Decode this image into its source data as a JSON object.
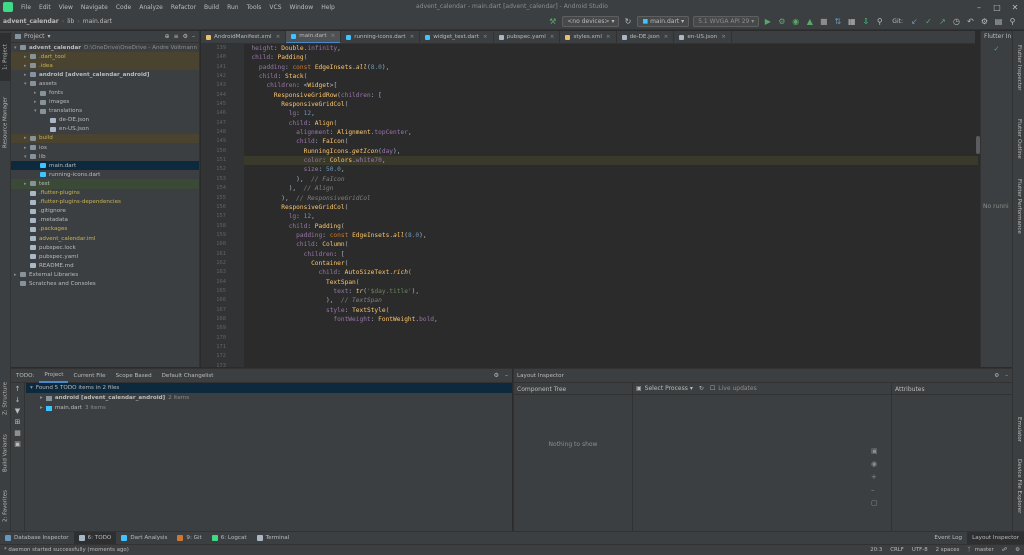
{
  "window": {
    "title": "advent_calendar - main.dart [advent_calendar] - Android Studio",
    "menu": [
      "File",
      "Edit",
      "View",
      "Navigate",
      "Code",
      "Analyze",
      "Refactor",
      "Build",
      "Run",
      "Tools",
      "VCS",
      "Window",
      "Help"
    ]
  },
  "navbar": {
    "breadcrumbs": [
      "advent_calendar",
      "lib",
      "main.dart"
    ],
    "device": "<no devices>",
    "run_config": "main.dart",
    "emulator": "5.1 WVGA API 29",
    "git_label": "Git:"
  },
  "left_stripe": [
    "1: Project",
    "Resource Manager",
    "Z: Structure",
    "Build Variants",
    "2: Favorites"
  ],
  "right_stripe": [
    "Flutter Inspector",
    "Flutter Outline",
    "Flutter Performance",
    "Emulator",
    "Device File Explorer"
  ],
  "project": {
    "header": "Project",
    "tree": [
      {
        "label": "advent_calendar",
        "extra": "D:\\OneDrive\\OneDrive - Andre Voltmann",
        "depth": 0,
        "type": "folder",
        "state": "open",
        "style": "bold"
      },
      {
        "label": ".dart_tool",
        "depth": 1,
        "type": "folder",
        "state": "closed",
        "style": "excluded"
      },
      {
        "label": ".idea",
        "depth": 1,
        "type": "folder",
        "state": "closed",
        "style": "excluded"
      },
      {
        "label": "android [advent_calendar_android]",
        "depth": 1,
        "type": "folder",
        "state": "closed",
        "style": "bold"
      },
      {
        "label": "assets",
        "depth": 1,
        "type": "folder",
        "state": "open",
        "style": ""
      },
      {
        "label": "fonts",
        "depth": 2,
        "type": "folder",
        "state": "closed",
        "style": ""
      },
      {
        "label": "images",
        "depth": 2,
        "type": "folder",
        "state": "closed",
        "style": ""
      },
      {
        "label": "translations",
        "depth": 2,
        "type": "folder",
        "state": "open",
        "style": ""
      },
      {
        "label": "de-DE.json",
        "depth": 3,
        "type": "file",
        "state": "",
        "style": ""
      },
      {
        "label": "en-US.json",
        "depth": 3,
        "type": "file",
        "state": "",
        "style": ""
      },
      {
        "label": "build",
        "depth": 1,
        "type": "folder",
        "state": "closed",
        "style": "excluded"
      },
      {
        "label": "ios",
        "depth": 1,
        "type": "folder",
        "state": "closed",
        "style": ""
      },
      {
        "label": "lib",
        "depth": 1,
        "type": "folder",
        "state": "open",
        "style": ""
      },
      {
        "label": "main.dart",
        "depth": 2,
        "type": "dart",
        "state": "",
        "style": "selected"
      },
      {
        "label": "running-icons.dart",
        "depth": 2,
        "type": "dart",
        "state": "",
        "style": ""
      },
      {
        "label": "test",
        "depth": 1,
        "type": "folder",
        "state": "closed",
        "style": "test"
      },
      {
        "label": ".flutter-plugins",
        "depth": 1,
        "type": "file",
        "state": "",
        "style": "yellow"
      },
      {
        "label": ".flutter-plugins-dependencies",
        "depth": 1,
        "type": "file",
        "state": "",
        "style": "yellow"
      },
      {
        "label": ".gitignore",
        "depth": 1,
        "type": "file",
        "state": "",
        "style": ""
      },
      {
        "label": ".metadata",
        "depth": 1,
        "type": "file",
        "state": "",
        "style": ""
      },
      {
        "label": ".packages",
        "depth": 1,
        "type": "file",
        "state": "",
        "style": "yellow"
      },
      {
        "label": "advent_calendar.iml",
        "depth": 1,
        "type": "file",
        "state": "",
        "style": "yellow"
      },
      {
        "label": "pubspec.lock",
        "depth": 1,
        "type": "file",
        "state": "",
        "style": ""
      },
      {
        "label": "pubspec.yaml",
        "depth": 1,
        "type": "file",
        "state": "",
        "style": ""
      },
      {
        "label": "README.md",
        "depth": 1,
        "type": "file",
        "state": "",
        "style": ""
      },
      {
        "label": "External Libraries",
        "depth": 0,
        "type": "folder",
        "state": "closed",
        "style": ""
      },
      {
        "label": "Scratches and Consoles",
        "depth": 0,
        "type": "folder",
        "state": "",
        "style": ""
      }
    ]
  },
  "editor": {
    "tabs": [
      {
        "label": "AndroidManifest.xml",
        "color": "#e8bf6a"
      },
      {
        "label": "main.dart",
        "color": "#40c4ff",
        "active": true
      },
      {
        "label": "running-icons.dart",
        "color": "#40c4ff"
      },
      {
        "label": "widget_test.dart",
        "color": "#40c4ff"
      },
      {
        "label": "pubspec.yaml",
        "color": "#a9b7c6"
      },
      {
        "label": "styles.xml",
        "color": "#e8bf6a"
      },
      {
        "label": "de-DE.json",
        "color": "#a9b7c6"
      },
      {
        "label": "en-US.json",
        "color": "#a9b7c6"
      }
    ],
    "first_line": 139,
    "line_count": 35
  },
  "flutter_panel": {
    "title": "Flutter In",
    "empty": "No runni"
  },
  "todo": {
    "tabs": [
      "TODO:",
      "Project",
      "Current File",
      "Scope Based",
      "Default Changelist"
    ],
    "summary": "Found 5 TODO items in 2 files",
    "items": [
      {
        "label": "android [advent_calendar_android]",
        "count": "2 items"
      },
      {
        "label": "main.dart",
        "count": "3 items"
      }
    ]
  },
  "layout_inspector": {
    "title": "Layout Inspector",
    "component_tree": "Component Tree",
    "nothing": "Nothing to show",
    "select_process": "Select Process",
    "live_updates": "Live updates",
    "attributes": "Attributes"
  },
  "bottom_tabs": [
    {
      "label": "Database Inspector",
      "color": "#6897bb"
    },
    {
      "label": "6: TODO",
      "color": "#a9b7c6",
      "active": true
    },
    {
      "label": "Dart Analysis",
      "color": "#40c4ff"
    },
    {
      "label": "9: Git",
      "color": "#cc7832"
    },
    {
      "label": "6: Logcat",
      "color": "#3ddc84"
    },
    {
      "label": "Terminal",
      "color": "#a9b7c6"
    }
  ],
  "bottom_right_tabs": [
    "Event Log",
    "Layout Inspector"
  ],
  "status": {
    "message": "* daemon started successfully (moments ago)",
    "position": "20:3",
    "line_sep": "CRLF",
    "encoding": "UTF-8",
    "indent": "2 spaces",
    "branch": "master"
  }
}
